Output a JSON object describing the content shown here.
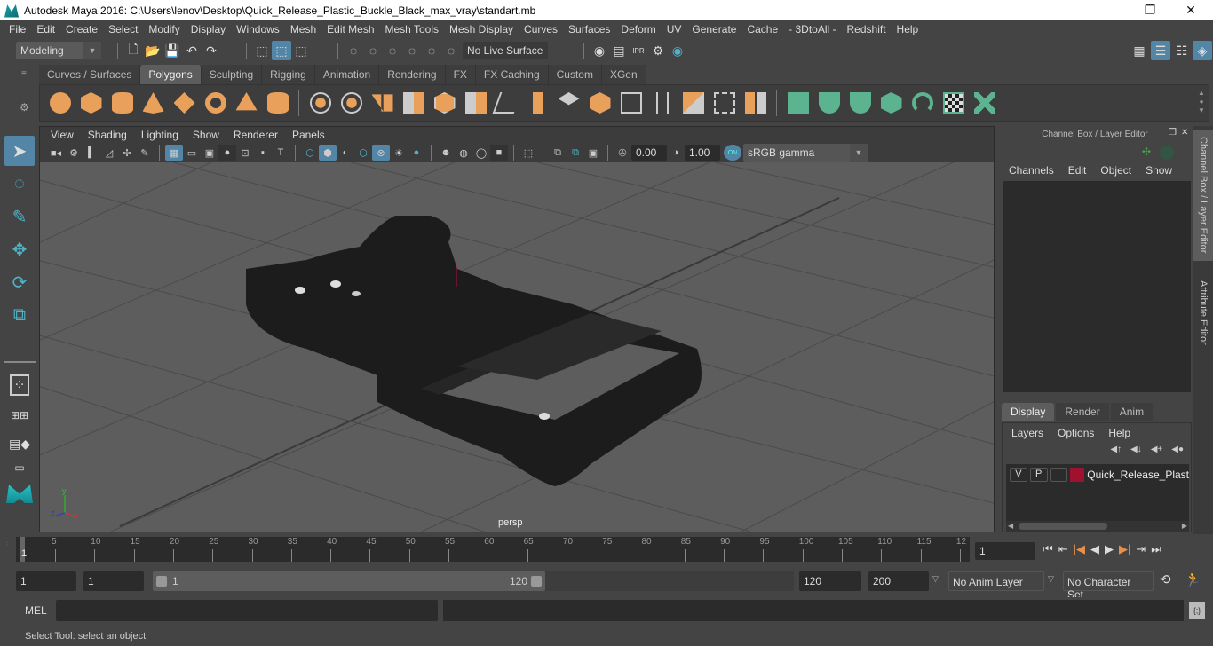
{
  "window": {
    "title": "Autodesk Maya 2016: C:\\Users\\lenov\\Desktop\\Quick_Release_Plastic_Buckle_Black_max_vray\\standart.mb",
    "minimize": "—",
    "restore": "❐",
    "close": "✕"
  },
  "menubar": [
    "File",
    "Edit",
    "Create",
    "Select",
    "Modify",
    "Display",
    "Windows",
    "Mesh",
    "Edit Mesh",
    "Mesh Tools",
    "Mesh Display",
    "Curves",
    "Surfaces",
    "Deform",
    "UV",
    "Generate",
    "Cache",
    "- 3DtoAll -",
    "Redshift",
    "Help"
  ],
  "statusline": {
    "mode": "Modeling",
    "live_surface": "No Live Surface"
  },
  "shelf": {
    "tabs": [
      "Curves / Surfaces",
      "Polygons",
      "Sculpting",
      "Rigging",
      "Animation",
      "Rendering",
      "FX",
      "FX Caching",
      "Custom",
      "XGen"
    ],
    "active_tab": "Polygons"
  },
  "viewport": {
    "menus": [
      "View",
      "Shading",
      "Lighting",
      "Show",
      "Renderer",
      "Panels"
    ],
    "exposure": "0.00",
    "gamma": "1.00",
    "color_mgmt_toggle": "ON",
    "color_space": "sRGB gamma",
    "camera_label": "persp",
    "axis": {
      "x": "x",
      "y": "y",
      "z": "z"
    }
  },
  "channel_box": {
    "title": "Channel Box / Layer Editor",
    "menus": [
      "Channels",
      "Edit",
      "Object",
      "Show"
    ]
  },
  "layer_editor": {
    "tabs": [
      "Display",
      "Render",
      "Anim"
    ],
    "active_tab": "Display",
    "menus": [
      "Layers",
      "Options",
      "Help"
    ],
    "layers": [
      {
        "v": "V",
        "p": "P",
        "color": "#a0112e",
        "name": "Quick_Release_Plastic_"
      }
    ]
  },
  "side_tabs": [
    "Channel Box / Layer Editor",
    "Attribute Editor"
  ],
  "timeline": {
    "ticks": [
      "5",
      "10",
      "15",
      "20",
      "25",
      "30",
      "35",
      "40",
      "45",
      "50",
      "55",
      "60",
      "65",
      "70",
      "75",
      "80",
      "85",
      "90",
      "95",
      "100",
      "105",
      "110",
      "115",
      "12"
    ],
    "current_frame_marker": "1",
    "current_frame": "1"
  },
  "range": {
    "start": "1",
    "playback_start": "1",
    "slider_start": "1",
    "slider_end": "120",
    "playback_end": "120",
    "end": "200",
    "anim_layer": "No Anim Layer",
    "character_set": "No Character Set"
  },
  "command": {
    "label": "MEL",
    "input": "",
    "output": ""
  },
  "helpline": "Select Tool: select an object"
}
